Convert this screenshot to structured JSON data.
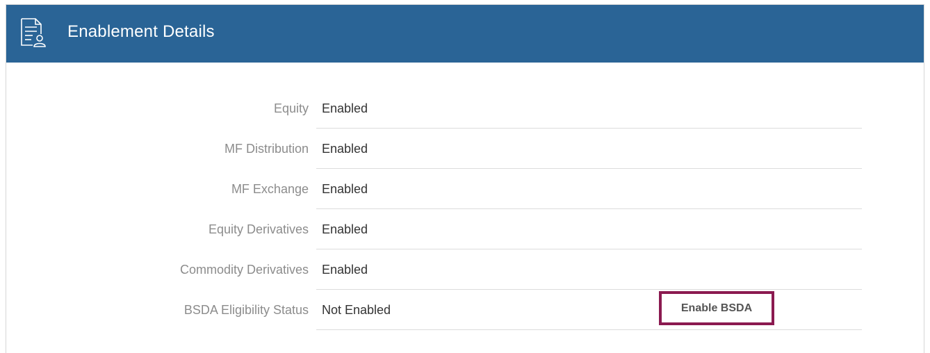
{
  "header": {
    "title": "Enablement Details",
    "icon": "document-user-icon",
    "background_color": "#2a6496"
  },
  "rows": [
    {
      "label": "Equity",
      "value": "Enabled"
    },
    {
      "label": "MF Distribution",
      "value": "Enabled"
    },
    {
      "label": "MF Exchange",
      "value": "Enabled"
    },
    {
      "label": "Equity Derivatives",
      "value": "Enabled"
    },
    {
      "label": "Commodity Derivatives",
      "value": "Enabled"
    },
    {
      "label": "BSDA Eligibility Status",
      "value": "Not Enabled"
    }
  ],
  "bsda_action": {
    "label": "Enable BSDA",
    "highlight_color": "#8b1a50"
  }
}
